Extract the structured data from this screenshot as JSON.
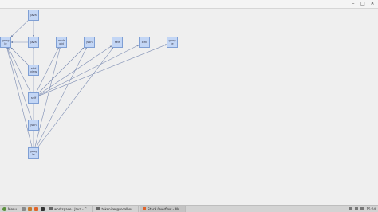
{
  "window": {
    "controls": [
      "–",
      "□",
      "✕"
    ]
  },
  "graph": {
    "nodes": [
      {
        "id": "java_top",
        "label": "java"
      },
      {
        "id": "google_left",
        "label": "goog\nle"
      },
      {
        "id": "java_mid",
        "label": "java"
      },
      {
        "id": "android",
        "label": "andr\noid"
      },
      {
        "id": "json_top",
        "label": "json"
      },
      {
        "id": "self_top",
        "label": "self"
      },
      {
        "id": "xml",
        "label": "xml"
      },
      {
        "id": "google_right",
        "label": "goog\nle"
      },
      {
        "id": "addview",
        "label": "add\nview"
      },
      {
        "id": "self_mid",
        "label": "self"
      },
      {
        "id": "json_low",
        "label": "json"
      },
      {
        "id": "google_bottom",
        "label": "goog\nle"
      }
    ],
    "edges": [
      [
        "java_top",
        "google_left"
      ],
      [
        "java_top",
        "java_mid"
      ],
      [
        "java_mid",
        "google_left"
      ],
      [
        "addview",
        "google_left"
      ],
      [
        "self_mid",
        "google_left"
      ],
      [
        "self_mid",
        "android"
      ],
      [
        "self_mid",
        "json_top"
      ],
      [
        "self_mid",
        "self_top"
      ],
      [
        "self_mid",
        "xml"
      ],
      [
        "self_mid",
        "google_right"
      ],
      [
        "json_low",
        "google_left"
      ],
      [
        "google_bottom",
        "google_left"
      ],
      [
        "google_bottom",
        "java_mid"
      ],
      [
        "google_bottom",
        "android"
      ],
      [
        "google_bottom",
        "json_top"
      ],
      [
        "google_bottom",
        "self_top"
      ]
    ]
  },
  "taskbar": {
    "menu_label": "Menu",
    "tasks": [
      {
        "label": "workspace - Java - C...",
        "active": false
      },
      {
        "label": "tokenizer@localhos...",
        "active": false
      },
      {
        "label": "Stack Overflow - Mo...",
        "active": true
      }
    ],
    "clock": "15:04"
  }
}
